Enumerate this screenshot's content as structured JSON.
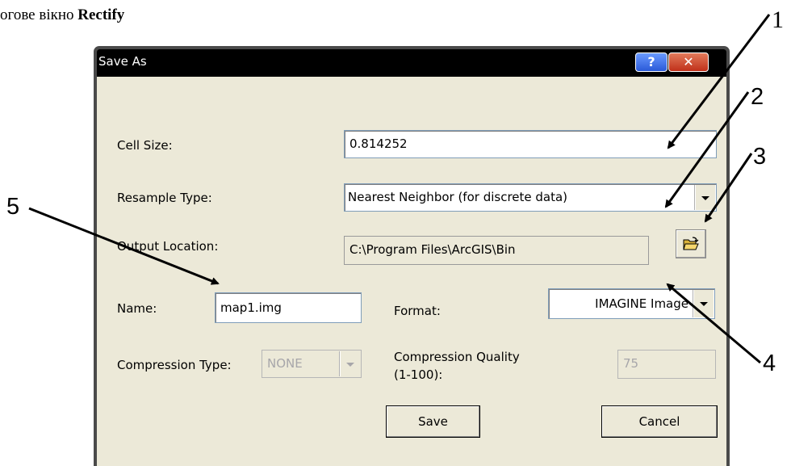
{
  "caption": {
    "prefix": "огове вікно ",
    "bold": "Rectify"
  },
  "dialog": {
    "title": "Save As",
    "help_label": "?",
    "close_label": "✕"
  },
  "fields": {
    "cell_size": {
      "label": "Cell Size:",
      "value": "0.814252"
    },
    "resample_type": {
      "label": "Resample Type:",
      "value": "Nearest Neighbor (for discrete data)"
    },
    "output_location": {
      "label": "Output Location:",
      "value": "C:\\Program Files\\ArcGIS\\Bin"
    },
    "name": {
      "label": "Name:",
      "value": "map1.img"
    },
    "format": {
      "label": "Format:",
      "value": "IMAGINE Image"
    },
    "compression_type": {
      "label": "Compression Type:",
      "value": "NONE"
    },
    "compression_quality": {
      "label_line1": "Compression Quality",
      "label_line2": "(1-100):",
      "value": "75"
    }
  },
  "buttons": {
    "save": "Save",
    "cancel": "Cancel"
  },
  "callouts": [
    "1",
    "2",
    "3",
    "4",
    "5"
  ],
  "icons": {
    "folder": "open-folder-icon",
    "help": "help-icon",
    "close": "close-icon"
  }
}
